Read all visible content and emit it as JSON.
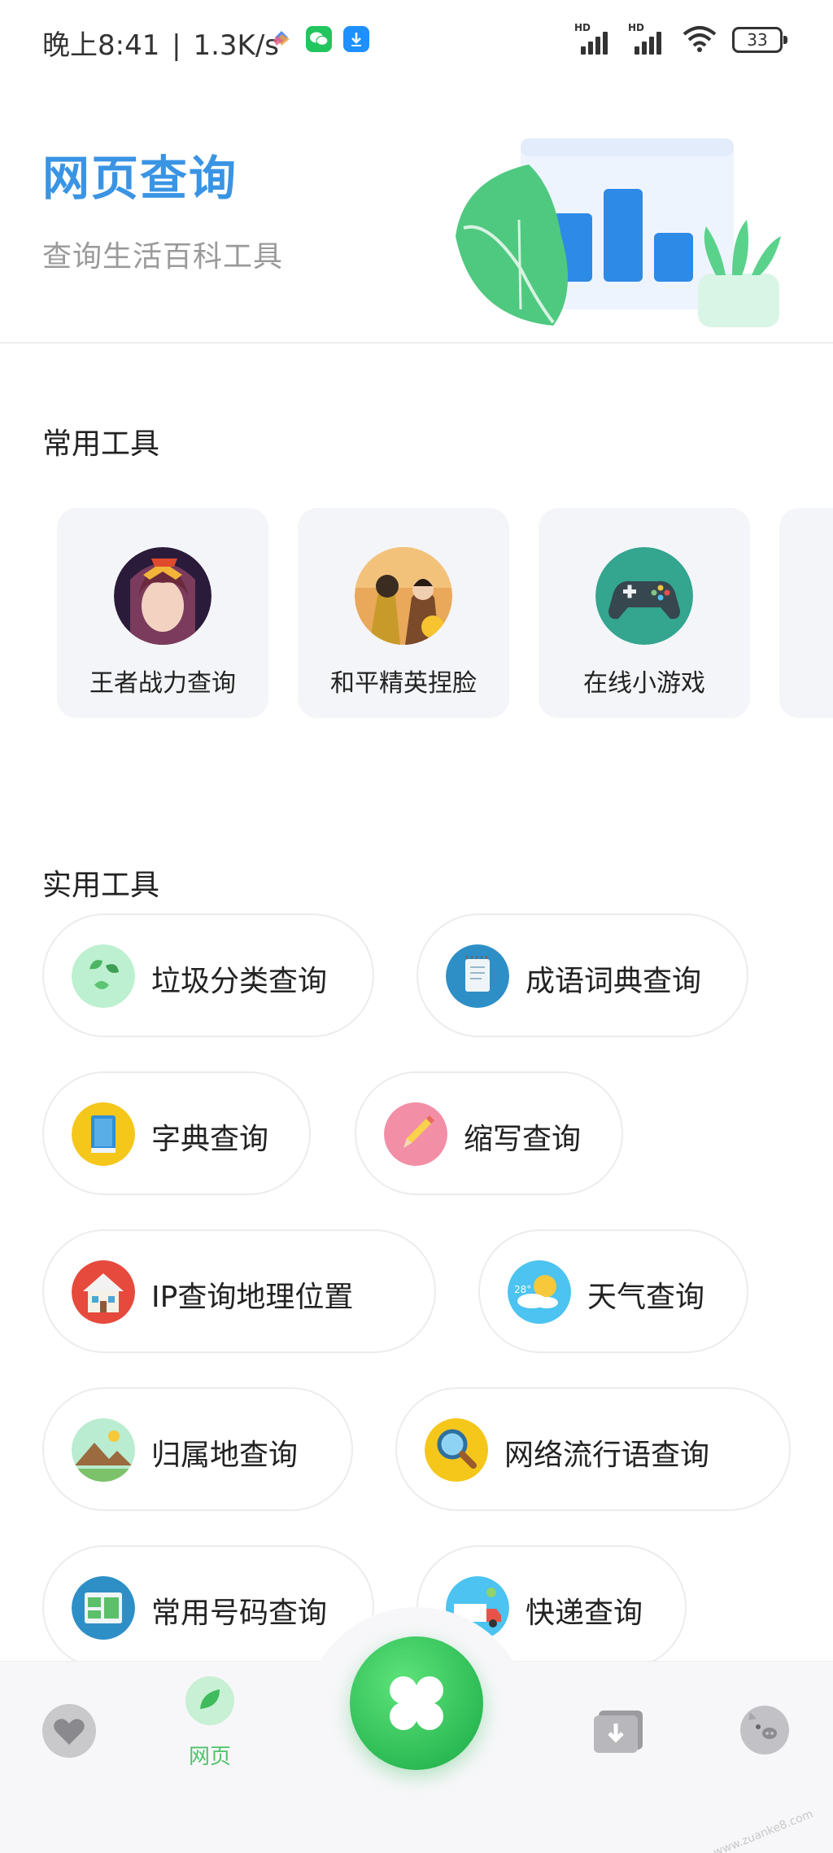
{
  "status_bar": {
    "time": "晚上8:41",
    "speed": "1.3K/s",
    "separator": "|",
    "signal_label": "HD",
    "battery": "33",
    "icons": [
      "mi-cloud-icon",
      "wechat-icon",
      "download-icon",
      "signal-icon",
      "wifi-icon",
      "battery-icon"
    ]
  },
  "header": {
    "title": "网页查询",
    "subtitle": "查询生活百科工具"
  },
  "sections": {
    "common_title": "常用工具",
    "practical_title": "实用工具"
  },
  "common_tools": [
    {
      "label": "王者战力查询",
      "icon": "honor-of-kings-avatar"
    },
    {
      "label": "和平精英捏脸",
      "icon": "peacekeeper-elite-avatar"
    },
    {
      "label": "在线小游戏",
      "icon": "gamepad-icon"
    }
  ],
  "practical_tools": [
    {
      "label": "垃圾分类查询",
      "icon": "leaf-icon"
    },
    {
      "label": "成语词典查询",
      "icon": "notebook-icon"
    },
    {
      "label": "字典查询",
      "icon": "dictionary-icon"
    },
    {
      "label": "缩写查询",
      "icon": "pencil-icon"
    },
    {
      "label": "IP查询地理位置",
      "icon": "house-icon"
    },
    {
      "label": "天气查询",
      "icon": "weather-icon",
      "temp_text": "28°"
    },
    {
      "label": "归属地查询",
      "icon": "mountain-icon"
    },
    {
      "label": "网络流行语查询",
      "icon": "magnifier-icon"
    },
    {
      "label": "常用号码查询",
      "icon": "phone-book-icon"
    },
    {
      "label": "快递查询",
      "icon": "delivery-truck-icon"
    }
  ],
  "bottom_nav": {
    "items": [
      {
        "name": "favorites",
        "icon": "heart-icon"
      },
      {
        "name": "web",
        "icon": "leaf-tab-icon",
        "label": "网页",
        "active": true
      },
      {
        "name": "home",
        "icon": "clover-icon"
      },
      {
        "name": "downloads",
        "icon": "download-box-icon"
      },
      {
        "name": "profile",
        "icon": "pig-icon"
      }
    ]
  },
  "watermark": "www.zuanke8.com",
  "colors": {
    "title_blue": "#3a94e4",
    "nav_green": "#4fc36a",
    "fab_green": "#2dbb55"
  }
}
